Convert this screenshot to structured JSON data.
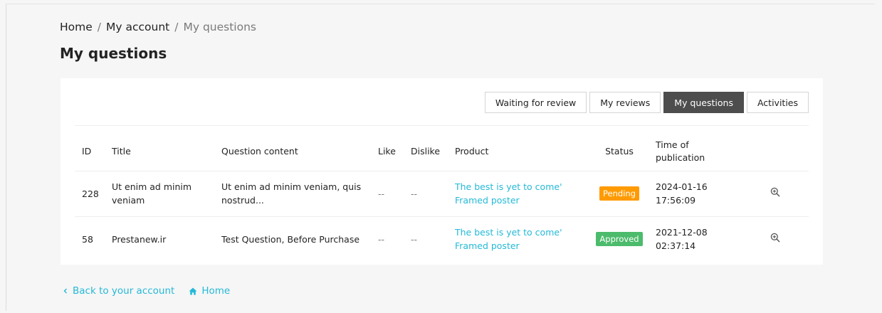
{
  "breadcrumb": {
    "home": "Home",
    "account": "My account",
    "current": "My questions",
    "separator": "/"
  },
  "page_title": "My questions",
  "tabs": [
    {
      "label": "Waiting for review",
      "active": false
    },
    {
      "label": "My reviews",
      "active": false
    },
    {
      "label": "My questions",
      "active": true
    },
    {
      "label": "Activities",
      "active": false
    }
  ],
  "table": {
    "headers": [
      "ID",
      "Title",
      "Question content",
      "Like",
      "Dislike",
      "Product",
      "Status",
      "Time of publication"
    ],
    "rows": [
      {
        "id": "228",
        "title": "Ut enim ad minim veniam",
        "content": "Ut enim ad minim veniam, quis nostrud...",
        "like": "--",
        "dislike": "--",
        "product": "The best is yet to come' Framed poster",
        "status": "Pending",
        "status_color": "#ff9a00",
        "date": "2024-01-16",
        "time": "17:56:09"
      },
      {
        "id": "58",
        "title": "Prestanew.ir",
        "content": "Test Question, Before Purchase",
        "like": "--",
        "dislike": "--",
        "product": "The best is yet to come' Framed poster",
        "status": "Approved",
        "status_color": "#4cbb6c",
        "date": "2021-12-08",
        "time": "02:37:14"
      }
    ]
  },
  "footer": {
    "back_label": "Back to your account",
    "home_label": "Home"
  },
  "colors": {
    "link": "#25b9d7",
    "active_tab": "#4d4d4d"
  }
}
